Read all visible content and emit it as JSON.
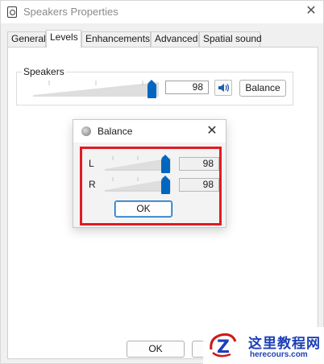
{
  "window": {
    "title": "Speakers Properties",
    "close_glyph": "✕"
  },
  "tabs": [
    {
      "label": "General"
    },
    {
      "label": "Levels",
      "active": true
    },
    {
      "label": "Enhancements"
    },
    {
      "label": "Advanced"
    },
    {
      "label": "Spatial sound"
    }
  ],
  "levels": {
    "group_label": "Speakers",
    "volume_value": "98",
    "volume_level": 98,
    "balance_button": "Balance"
  },
  "balance_dialog": {
    "title": "Balance",
    "close_glyph": "✕",
    "channels": [
      {
        "label": "L",
        "value": "98",
        "level": 98
      },
      {
        "label": "R",
        "value": "98",
        "level": 98
      }
    ],
    "ok_button": "OK"
  },
  "footer": {
    "ok_button": "OK"
  },
  "watermark": {
    "title": "这里教程网",
    "url": "herecours.com"
  },
  "colors": {
    "accent": "#0067c0",
    "highlight": "#e01b24",
    "watermark": "#1d3fb8"
  },
  "icons": [
    "speakers-app-icon",
    "close-icon",
    "speaker-volume-icon",
    "balance-dialog-icon"
  ]
}
